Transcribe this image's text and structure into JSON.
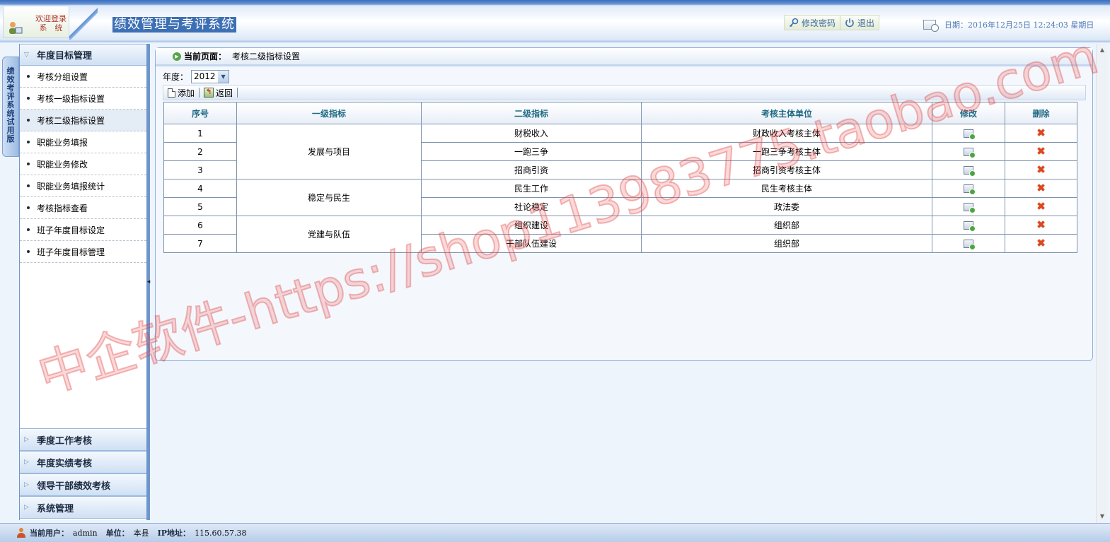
{
  "header": {
    "welcome_line1": "欢迎登录",
    "welcome_line2": "系　统",
    "title": "绩效管理与考评系统",
    "change_password": "修改密码",
    "logout": "退出",
    "date_text": "日期：2016年12月25日  12:24:03 星期日"
  },
  "vertical_tab": [
    "绩",
    "效",
    "考",
    "评",
    "系",
    "统",
    "试",
    "用",
    "版"
  ],
  "sidebar": {
    "active_group": "年度目标管理",
    "items": [
      {
        "label": "考核分组设置"
      },
      {
        "label": "考核一级指标设置"
      },
      {
        "label": "考核二级指标设置"
      },
      {
        "label": "职能业务填报"
      },
      {
        "label": "职能业务修改"
      },
      {
        "label": "职能业务填报统计"
      },
      {
        "label": "考核指标查看"
      },
      {
        "label": "班子年度目标设定"
      },
      {
        "label": "班子年度目标管理"
      }
    ],
    "other_groups": [
      {
        "label": "季度工作考核"
      },
      {
        "label": "年度实绩考核"
      },
      {
        "label": "领导干部绩效考核"
      },
      {
        "label": "系统管理"
      }
    ]
  },
  "breadcrumb": {
    "label": "当前页面：",
    "page": "考核二级指标设置"
  },
  "filter": {
    "year_label": "年度：",
    "year_value": "2012"
  },
  "toolbar": {
    "add": "添加",
    "back": "返回"
  },
  "table": {
    "headers": {
      "no": "序号",
      "level1": "一级指标",
      "level2": "二级指标",
      "unit": "考核主体单位",
      "edit": "修改",
      "delete": "删除"
    },
    "groups": [
      {
        "level1": "发展与项目"
      },
      {
        "level1": "稳定与民生"
      },
      {
        "level1": "党建与队伍"
      }
    ],
    "rows": [
      {
        "no": "1",
        "level2": "财税收入",
        "unit": "财政收入考核主体"
      },
      {
        "no": "2",
        "level2": "一跑三争",
        "unit": "一跑三争考核主体"
      },
      {
        "no": "3",
        "level2": "招商引资",
        "unit": "招商引资考核主体"
      },
      {
        "no": "4",
        "level2": "民生工作",
        "unit": "民生考核主体"
      },
      {
        "no": "5",
        "level2": "社论稳定",
        "unit": "政法委"
      },
      {
        "no": "6",
        "level2": "组织建设",
        "unit": "组织部"
      },
      {
        "no": "7",
        "level2": "干部队伍建设",
        "unit": "组织部"
      }
    ]
  },
  "footer": {
    "user_label": "当前用户：",
    "user": "admin",
    "unit_label": "单位：",
    "unit": "本县",
    "ip_label": "IP地址：",
    "ip": "115.60.57.38"
  },
  "watermark": "中企软件-https://shop113983775.taobao.com",
  "colors": {
    "accent": "#3d6fb4",
    "header_text": "#1f6a85",
    "delete": "#e0461c"
  }
}
